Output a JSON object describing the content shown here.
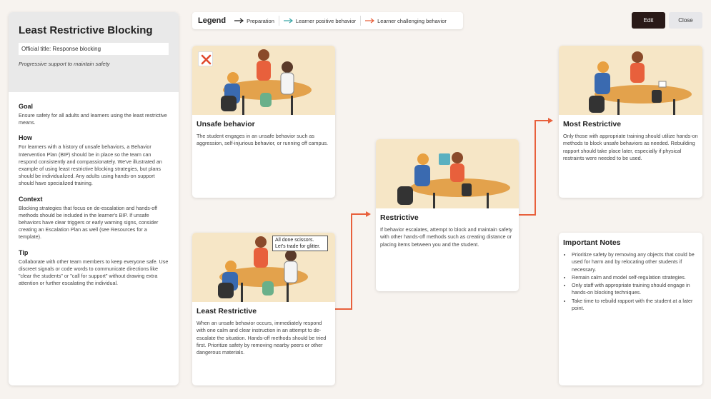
{
  "sidebar": {
    "title": "Least Restrictive Blocking",
    "official_title": "Official title: Response blocking",
    "subtitle": "Progressive support to maintain safety",
    "sections": [
      {
        "heading": "Goal",
        "text": "Ensure safety for all adults and learners using the least restrictive means."
      },
      {
        "heading": "How",
        "text": "For learners with a history of unsafe behaviors, a Behavior Intervention Plan (BIP) should be in place so the team can respond consistently and compassionately. We've illustrated an example of using least restrictive blocking strategies, but plans should be individualized. Any adults using hands-on support should have specialized training."
      },
      {
        "heading": "Context",
        "text": "Blocking strategies that focus on de-escalation and hands-off methods should be included in the learner's BIP. If unsafe behaviors have clear triggers or early warning signs, consider creating an Escalation Plan as well (see Resources for a template)."
      },
      {
        "heading": "Tip",
        "text": "Collaborate with other team members to keep everyone safe. Use discreet signals or code words to communicate directions like \"clear the students\" or \"call for support\" without drawing extra attention or further escalating the individual."
      }
    ]
  },
  "legend": {
    "title": "Legend",
    "items": [
      {
        "label": "Preparation",
        "color": "#222222"
      },
      {
        "label": "Learner positive behavior",
        "color": "#3aa6a6"
      },
      {
        "label": "Learner challenging behavior",
        "color": "#e8603c"
      }
    ]
  },
  "toolbar": {
    "edit_label": "Edit",
    "close_label": "Close"
  },
  "cards": {
    "unsafe": {
      "title": "Unsafe behavior",
      "text": "The student engages in an unsafe behavior such as aggression, self-injurious behavior, or running off campus."
    },
    "least": {
      "title": "Least Restrictive",
      "text": "When an unsafe behavior occurs, immediately respond with one calm and clear instruction in an attempt to de-escalate the situation. Hands-off methods should be tried first. Prioritize safety by removing nearby peers or other dangerous materials.",
      "bubble": "All done scissors. Let's trade for glitter."
    },
    "restrictive": {
      "title": "Restrictive",
      "text": "If behavior escalates, attempt to block and maintain safety with other hands-off methods such as creating distance or placing items between you and the student."
    },
    "most": {
      "title": "Most Restrictive",
      "text": "Only those with appropriate training should utilize hands-on methods to block unsafe behaviors as needed. Rebuilding rapport should take place later, especially if physical restraints were needed to be used."
    }
  },
  "notes": {
    "title": "Important Notes",
    "items": [
      "Prioritize safety by removing any objects that could be used for harm and by relocating other students if necessary.",
      "Remain calm and model self-regulation strategies.",
      "Only staff with appropriate training should engage in hands-on blocking techniques.",
      "Take time to rebuild rapport with the student at a later point."
    ]
  },
  "colors": {
    "accent_orange": "#e8603c",
    "dark_button": "#2a1a18",
    "illustration_bg": "#f6e6c6"
  }
}
